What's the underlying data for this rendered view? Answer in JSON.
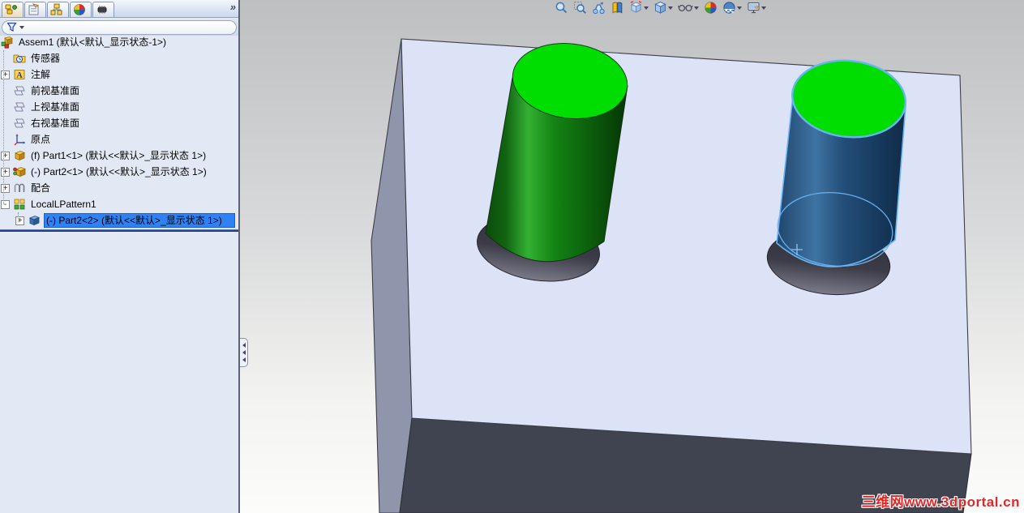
{
  "panel": {
    "overflow_chevron": "»",
    "tabs": [
      {
        "name": "featuremanager-tab",
        "active": true
      },
      {
        "name": "propertymanager-tab",
        "active": false
      },
      {
        "name": "configurationmanager-tab",
        "active": false
      },
      {
        "name": "dimxpertmanager-tab",
        "active": false
      },
      {
        "name": "displaymanager-tab",
        "active": false
      }
    ],
    "filter": {
      "icon": "filter-funnel-icon"
    }
  },
  "tree": {
    "root": {
      "label": "Assem1  (默认<默认_显示状态-1>)",
      "icon": "assembly-icon"
    },
    "items": [
      {
        "label": "传感器",
        "icon": "sensors-icon",
        "expander": ""
      },
      {
        "label": "注解",
        "icon": "annotations-icon",
        "expander": "+"
      },
      {
        "label": "前视基准面",
        "icon": "plane-icon",
        "expander": ""
      },
      {
        "label": "上视基准面",
        "icon": "plane-icon",
        "expander": ""
      },
      {
        "label": "右视基准面",
        "icon": "plane-icon",
        "expander": ""
      },
      {
        "label": "原点",
        "icon": "origin-icon",
        "expander": ""
      },
      {
        "label": "(f) Part1<1> (默认<<默认>_显示状态 1>)",
        "icon": "part-icon-yellow",
        "expander": "+"
      },
      {
        "label": "(-) Part2<1> (默认<<默认>_显示状态 1>)",
        "icon": "part-icon-yellow",
        "expander": "+"
      },
      {
        "label": "配合",
        "icon": "mates-icon",
        "expander": "+"
      },
      {
        "label": "LocalLPattern1",
        "icon": "pattern-icon",
        "expander": "-"
      },
      {
        "label": "(-) Part2<2> (默认<<默认>_显示状态 1>)",
        "icon": "part-icon-blue",
        "expander": "+",
        "selected": true
      }
    ]
  },
  "viewport": {
    "hud_toolbar": [
      "zoom-to-fit",
      "zoom-to-area",
      "previous-view",
      "section-view",
      "view-orientation",
      "display-style",
      "hide-show-items",
      "edit-appearance",
      "apply-scene",
      "view-settings"
    ],
    "watermark": "三维网www.3dportal.cn",
    "scene": {
      "base_block": {
        "top_face": "#dce3f7",
        "left_face": "#8f96ac",
        "front_face": "#404450"
      },
      "green_cylinder": {
        "top": "#00dd00",
        "body": "green gradient"
      },
      "blue_cylinder_selected": {
        "top": "#00dd00",
        "body": "navy gradient",
        "selection_edge": "#69b4f2"
      },
      "holes": "#33333d"
    }
  },
  "colors": {
    "selection_highlight": "#2f82f5",
    "rollback_bar": "#20409a",
    "panel_bg": "#e3e9f4",
    "selection_edge_blue": "#69b4f2",
    "bright_green": "#00dd00",
    "watermark_red": "#e02828"
  }
}
